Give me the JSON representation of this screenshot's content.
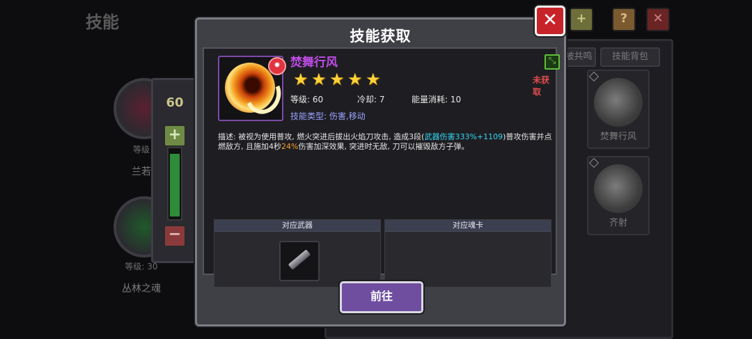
{
  "background": {
    "title": "技能",
    "tabs": [
      "被共鸣",
      "技能背包"
    ],
    "cards": [
      {
        "name": "焚舞行风"
      },
      {
        "name": "齐射"
      }
    ],
    "left_chars": [
      {
        "level": "等级",
        "name": "兰若"
      },
      {
        "level": "等级: 30",
        "name": "丛林之魂"
      }
    ],
    "slider_value": "60",
    "slider_plus": "+",
    "slider_minus": "−"
  },
  "modal": {
    "title": "技能获取",
    "close_label": "✕",
    "skill": {
      "name": "焚舞行风",
      "stars": 5,
      "status": "未获取",
      "level_label": "等级: 60",
      "cooldown_label": "冷却: 7",
      "energy_label": "能量消耗: 10",
      "type_label": "技能类型:",
      "type_value": "伤害,移动",
      "desc_1": "描述: 被视为使用普攻, 燃火突进后拔出火焰刀攻击, 造成3段(",
      "desc_highlight_1": "武器伤害333%+1109",
      "desc_2": ")普攻伤害并点燃敌方, 且施加4秒",
      "desc_highlight_2": "24%",
      "desc_3": "伤害加深效果, 突进时无敌, 刀可以摧毁敌方子弹。"
    },
    "weapon_panel_title": "对应武器",
    "soul_card_panel_title": "对应魂卡",
    "go_button": "前往"
  },
  "colors": {
    "skill_name": "#c04ce8",
    "status": "#e14d4d",
    "highlight_cyan": "#34d6f2",
    "highlight_orange": "#f2a02a",
    "go_button": "#6f4d9f",
    "close_button": "#c7242a"
  },
  "icons": {
    "close": "close-icon",
    "skill": "fire-slash-icon",
    "weapon": "dagger-icon",
    "status": "acquire-status-icon"
  }
}
